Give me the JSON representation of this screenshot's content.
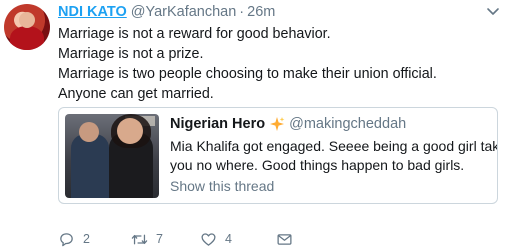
{
  "tweet": {
    "author_name": "NDI KATO",
    "author_handle": "@YarKafanchan",
    "separator": "·",
    "time": "26m",
    "lines": [
      "Marriage is not a reward for good behavior.",
      "Marriage is not a prize.",
      "Marriage is two people choosing to make their union official.",
      "Anyone can get married."
    ]
  },
  "quoted": {
    "name": "Nigerian Hero",
    "handle": "@makingcheddah",
    "lines": [
      "Mia Khalifa got engaged. Seeee being a good girl takes",
      "you no where. Good things happen to bad girls."
    ],
    "show_thread": "Show this thread"
  },
  "actions": {
    "reply_count": "2",
    "retweet_count": "7",
    "like_count": "4"
  },
  "colors": {
    "link": "#1da1f2",
    "muted": "#657786",
    "text": "#14171a",
    "sparkle": "#ffac33"
  },
  "icons": [
    "caret-down-icon",
    "sparkles-icon",
    "reply-icon",
    "retweet-icon",
    "heart-icon",
    "envelope-icon"
  ]
}
